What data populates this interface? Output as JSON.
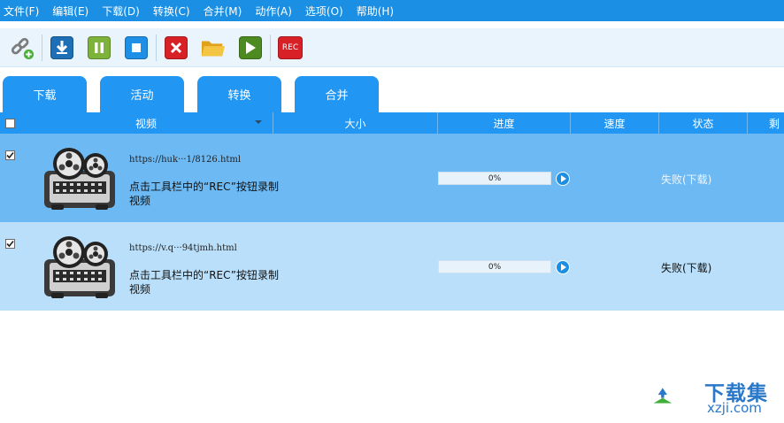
{
  "menu": {
    "items": [
      "文件(F)",
      "编辑(E)",
      "下载(D)",
      "转换(C)",
      "合并(M)",
      "动作(A)",
      "选项(O)",
      "帮助(H)"
    ]
  },
  "toolbar": {
    "buttons": [
      "add-link-icon",
      "download-icon",
      "pause-icon",
      "stop-icon",
      "delete-icon",
      "open-folder-icon",
      "play-icon",
      "rec-icon"
    ],
    "rec_label": "REC",
    "colors": {
      "download": "#1e6fb5",
      "pause": "#7db33a",
      "stop": "#1e8fe6",
      "delete": "#d82027",
      "folder": "#f1b62a",
      "play": "#4d8a21",
      "rec": "#d82027"
    }
  },
  "tabs": [
    "下载",
    "活动",
    "转换",
    "合并"
  ],
  "table": {
    "columns": [
      "视频",
      "大小",
      "进度",
      "速度",
      "状态",
      "剩"
    ],
    "rows": [
      {
        "checked": true,
        "url": "https://huk···1/8126.html",
        "hint": "点击工具栏中的“REC”按钮录制视频",
        "progress": "0%",
        "progress_value": 0,
        "status": "失败(下载)"
      },
      {
        "checked": true,
        "url": "https://v.q···94tjmh.html",
        "hint": "点击工具栏中的“REC”按钮录制视频",
        "progress": "0%",
        "progress_value": 0,
        "status": "失败(下载)"
      }
    ]
  },
  "watermark": {
    "cn": "下载集",
    "en": "xzji.com"
  },
  "colors": {
    "accent": "#2196f3",
    "menubar": "#1a8fe3",
    "row_selected": "#6cb9f4",
    "row_alt": "#b9dffa"
  }
}
